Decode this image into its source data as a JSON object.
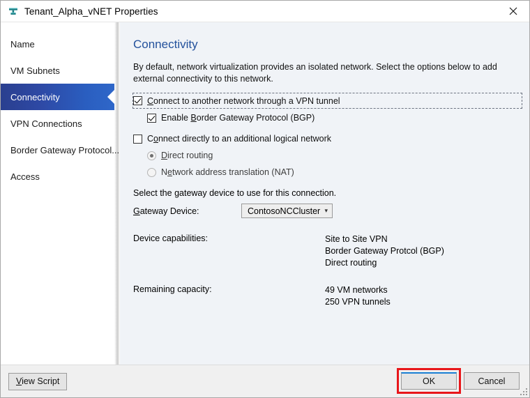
{
  "window": {
    "title": "Tenant_Alpha_vNET Properties",
    "icon": "network-subnet-icon",
    "close_icon": "close-icon"
  },
  "sidebar": {
    "items": [
      {
        "label": "Name",
        "selected": false
      },
      {
        "label": "VM Subnets",
        "selected": false
      },
      {
        "label": "Connectivity",
        "selected": true
      },
      {
        "label": "VPN Connections",
        "selected": false
      },
      {
        "label": "Border Gateway Protocol...",
        "selected": false
      },
      {
        "label": "Access",
        "selected": false
      }
    ],
    "selected_accent": "#2a4fa8"
  },
  "content": {
    "heading": "Connectivity",
    "heading_color": "#23519c",
    "description": "By default, network virtualization provides an isolated network. Select the options below to add external connectivity to this network.",
    "vpn_checkbox": {
      "label_prefix": "",
      "label_ak": "C",
      "label_rest": "onnect to another network through a VPN tunnel",
      "checked": true,
      "focused": true
    },
    "bgp_checkbox": {
      "label_prefix": "Enable ",
      "label_ak": "B",
      "label_rest": "order Gateway Protocol (BGP)",
      "checked": true
    },
    "logical_checkbox": {
      "label_prefix": "C",
      "label_ak": "o",
      "label_rest": "nnect directly to an additional logical network",
      "checked": false
    },
    "direct_routing_radio": {
      "label_prefix": "",
      "label_ak": "D",
      "label_rest": "irect routing",
      "checked": true,
      "disabled": true
    },
    "nat_radio": {
      "label_prefix": "N",
      "label_ak": "e",
      "label_rest": "twork address translation (NAT)",
      "checked": false,
      "disabled": true
    },
    "gateway_instruction": "Select the gateway device to use for this connection.",
    "gateway_label_prefix": "",
    "gateway_label_ak": "G",
    "gateway_label_rest": "ateway Device:",
    "gateway_value": "ContosoNCCluster",
    "gateway_caret": "chevron-down-icon",
    "device_capabilities_label": "Device capabilities:",
    "device_capabilities": [
      "Site to Site VPN",
      "Border Gateway Protcol (BGP)",
      "Direct routing"
    ],
    "remaining_capacity_label": "Remaining capacity:",
    "remaining_capacity": [
      "49 VM networks",
      "250 VPN tunnels"
    ]
  },
  "footer": {
    "view_script_prefix": "",
    "view_script_ak": "V",
    "view_script_rest": "iew Script",
    "ok_label": "OK",
    "cancel_label": "Cancel",
    "ok_highlight_color": "#e8161a",
    "ok_accent_color": "#1a7fd4"
  }
}
